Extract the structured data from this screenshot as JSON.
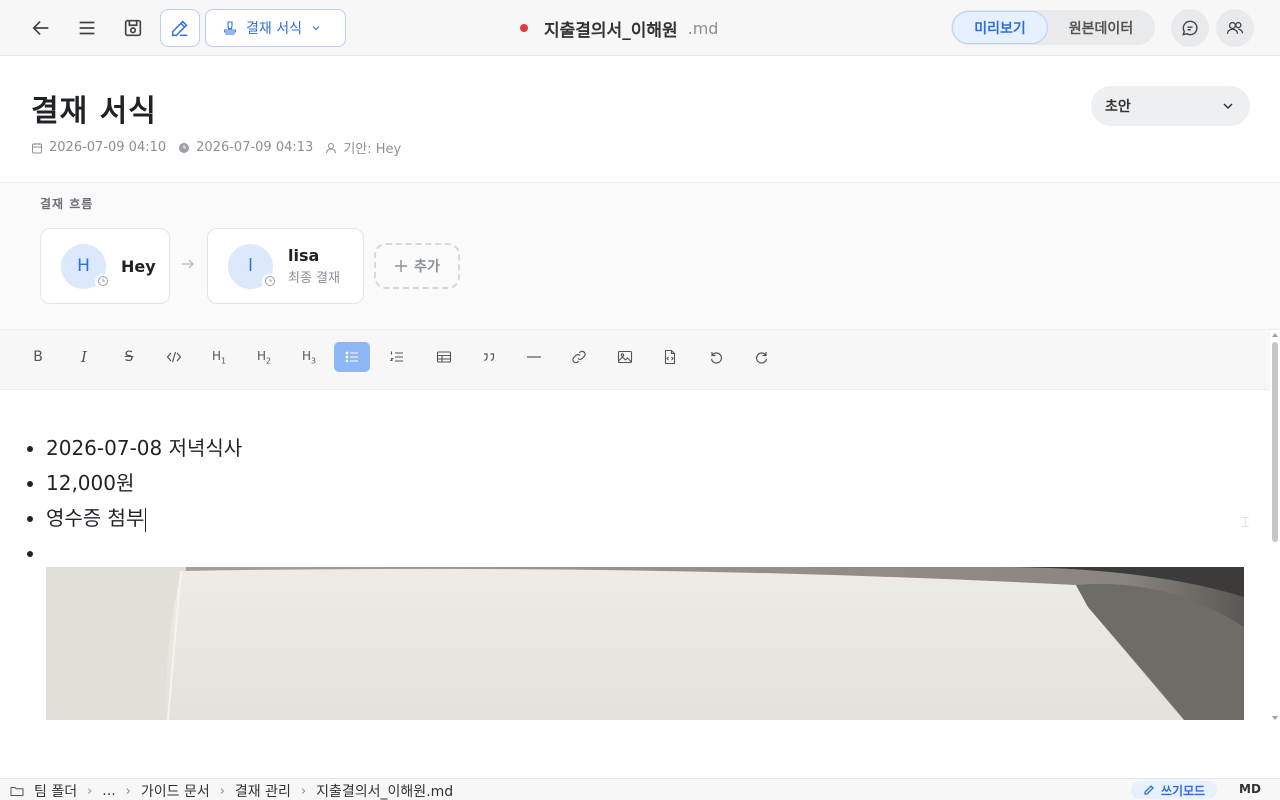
{
  "toolbar": {
    "template_label": "결재 서식",
    "doc_name": "지출결의서_이해원",
    "doc_ext": ".md",
    "view_options": [
      "미리보기",
      "원본데이터"
    ],
    "active_view": "미리보기",
    "icons": [
      "back-arrow-icon",
      "menu-icon",
      "save-icon",
      "pencil-icon",
      "stamp-icon",
      "chevron-down-icon",
      "comment-icon",
      "users-icon"
    ]
  },
  "header": {
    "title": "결재 서식",
    "created": "2026-07-09 04:10",
    "modified": "2026-07-09 04:13",
    "drafter": "기안: Hey",
    "status_value": "초안"
  },
  "approval": {
    "label": "결재 흐름",
    "steps": [
      {
        "initial": "H",
        "name": "Hey",
        "role": ""
      },
      {
        "initial": "l",
        "name": "lisa",
        "role": "최종 결재"
      }
    ],
    "add_label": "추가"
  },
  "format_toolbar": {
    "buttons": [
      "bold",
      "italic",
      "strikethrough",
      "code",
      "heading-1",
      "heading-2",
      "heading-3",
      "bullet-list",
      "ordered-list",
      "table",
      "quote",
      "horizontal-rule",
      "link",
      "image",
      "file",
      "undo",
      "redo"
    ],
    "active": "bullet-list",
    "h1": "H",
    "h1_sub": "1",
    "h2": "H",
    "h2_sub": "2",
    "h3": "H",
    "h3_sub": "3",
    "bold_glyph": "B",
    "italic_glyph": "I",
    "strike_glyph": "S"
  },
  "content": {
    "items": [
      "2026-07-08 저녁식사",
      "12,000원",
      "영수증 첨부",
      ""
    ]
  },
  "statusbar": {
    "breadcrumb": [
      "팀 폴더",
      "...",
      "가이드 문서",
      "결재 관리",
      "지출결의서_이해원.md"
    ],
    "mode_label": "쓰기모드",
    "format_label": "MD"
  },
  "colors": {
    "accent": "#2f6fd6",
    "unsaved_dot": "#e5393b",
    "active_format": "#8db7f5"
  }
}
